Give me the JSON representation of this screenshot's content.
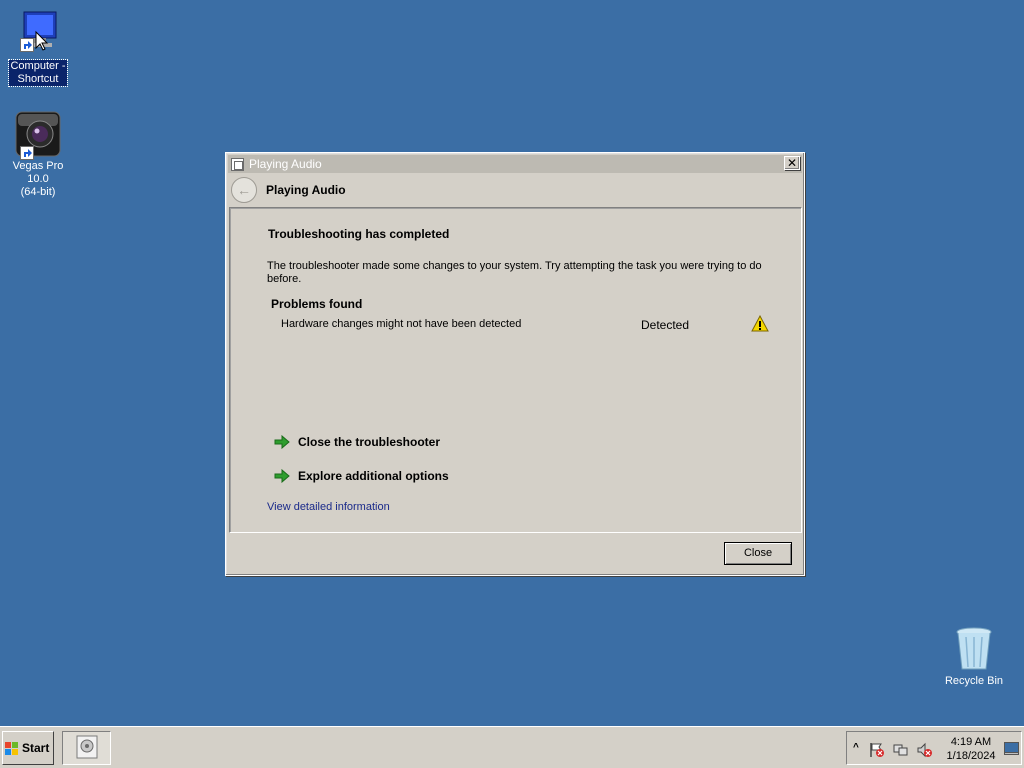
{
  "desktop": {
    "icons": [
      {
        "label_line1": "Computer -",
        "label_line2": "Shortcut",
        "icon": "computer-icon"
      },
      {
        "label_line1": "Vegas Pro 10.0",
        "label_line2": "(64-bit)",
        "icon": "camera-icon"
      },
      {
        "label_line1": "Recycle Bin",
        "icon": "recycle-bin-icon"
      }
    ]
  },
  "dialog": {
    "window_title": "Playing Audio",
    "nav_title": "Playing Audio",
    "heading": "Troubleshooting has completed",
    "description": "The troubleshooter made some changes to your system. Try attempting the task you were trying to do before.",
    "problems_title": "Problems found",
    "problems": [
      {
        "text": "Hardware changes might not have been detected",
        "status": "Detected",
        "icon": "warning-icon"
      }
    ],
    "links": [
      {
        "label": "Close the troubleshooter",
        "icon": "green-arrow-icon"
      },
      {
        "label": "Explore additional options",
        "icon": "green-arrow-icon"
      }
    ],
    "details_link": "View detailed information",
    "close_button": "Close",
    "close_glyph": "✕",
    "back_glyph": "←"
  },
  "taskbar": {
    "start_label": "Start",
    "expand_glyph": "^",
    "clock_time": "4:19 AM",
    "clock_date": "1/18/2024"
  },
  "colors": {
    "desktop_bg": "#3b6ea5",
    "dialog_bg": "#d4d0c8",
    "link_color": "#1a2a8a",
    "arrow_green": "#2e9d2e",
    "warning_yellow": "#f5d800"
  }
}
